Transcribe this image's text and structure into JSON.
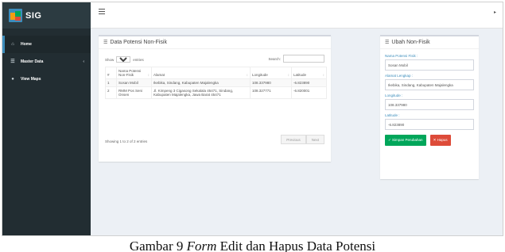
{
  "app": {
    "brand": "SIG"
  },
  "sidebar": {
    "items": [
      {
        "label": "Home",
        "icon": "home-icon",
        "active": true
      },
      {
        "label": "Master Data",
        "icon": "database-icon",
        "has_caret": true
      },
      {
        "label": "View Maps",
        "icon": "map-marker-icon"
      }
    ]
  },
  "list_panel": {
    "title": "Data Potensi Non-Fisik",
    "show_label": "Show",
    "entries_value": "10",
    "entries_label": "entries",
    "search_label": "Search:",
    "columns": [
      "#",
      "Nama Potensi Non-Fisik",
      "Alamat",
      "Longitude",
      "Latitude"
    ],
    "rows": [
      {
        "no": "1",
        "nama": "Sosan Mobil",
        "alamat": "Ikebika, Sindang, Kabupaten Majalengka",
        "longitude": "108.337980",
        "latitude": "-6.823890"
      },
      {
        "no": "2",
        "nama": "RMM Pos Seni Onsen",
        "alamat": "Jl. Kimpeng 3 Cigasong Sekalala 45471, Sindang, Kabupaten Majalengka, Jawa Barat 45471",
        "longitude": "108.327771",
        "latitude": "-6.820001"
      }
    ],
    "info": "Showing 1 to 2 of 2 entries",
    "prev": "Previous",
    "next": "Next"
  },
  "form_panel": {
    "title": "Ubah Non-Fisik",
    "fields": [
      {
        "label": "Nama Potensi Fisik :",
        "value": "Sosan Mobil"
      },
      {
        "label": "Alamat Lengkap :",
        "value": "Ikebika, Sindang, Kabupaten Majalengka"
      },
      {
        "label": "Longitude :",
        "value": "108.337980"
      },
      {
        "label": "Latitude :",
        "value": "-6.823890"
      }
    ],
    "save_label": "Simpan Perubahan",
    "delete_label": "Hapus"
  },
  "caption": {
    "prefix": "Gambar 9 ",
    "italic": "Form",
    "suffix": " Edit dan Hapus Data Potensi"
  },
  "colors": {
    "sidebar": "#222d32",
    "accent": "#3c8dbc",
    "success": "#00a65a",
    "danger": "#dd4b39"
  }
}
